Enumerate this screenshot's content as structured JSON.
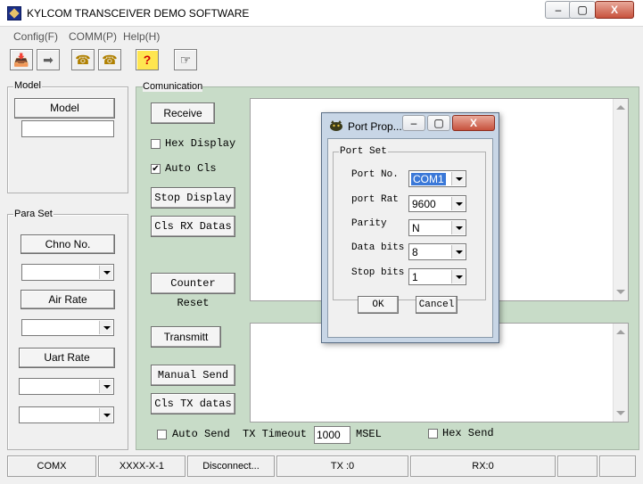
{
  "window": {
    "title": "KYLCOM TRANSCEIVER DEMO SOFTWARE",
    "minimize": "–",
    "maximize": "▢",
    "close": "X"
  },
  "menu": [
    {
      "label": "Config(F)"
    },
    {
      "label": "COMM(P)"
    },
    {
      "label": "Help(H)"
    }
  ],
  "toolbar": {
    "open": "📥",
    "send": "➡",
    "phone_call": "☎",
    "phone_hangup": "☎",
    "help": "?",
    "exit": "☞"
  },
  "model": {
    "group_label": "Model",
    "model_button": "Model",
    "model_value": ""
  },
  "para_set": {
    "group_label": "Para Set",
    "chno_button": "Chno No.",
    "chno_value": "",
    "air_rate_button": "Air Rate",
    "air_rate_value": "",
    "uart_rate_button": "Uart Rate",
    "uart_rate_value": "",
    "extra_value": ""
  },
  "comm": {
    "group_label": "Comunication",
    "receive_button": "Receive",
    "hex_display": "Hex Display",
    "auto_cls": "Auto Cls",
    "auto_cls_checked": true,
    "stop_display": "Stop Display",
    "cls_rx": "Cls RX Datas",
    "counter_reset": "Counter Reset",
    "transmit_button": "Transmitt",
    "manual_send": "Manual Send",
    "cls_tx": "Cls TX datas",
    "auto_send": "Auto Send",
    "tx_timeout_label": "TX Timeout",
    "tx_timeout_value": "1000",
    "msel": "MSEL",
    "hex_send": "Hex Send"
  },
  "status": {
    "port": "COMX",
    "model": "XXXX-X-1",
    "connection": "Disconnect...",
    "tx": "TX :0",
    "rx": "RX:0"
  },
  "dialog": {
    "title": "Port Prop...",
    "group_label": "Port Set",
    "port_no_label": "Port No.",
    "port_no_value": "COM1",
    "port_rate_label": "port Rat",
    "port_rate_value": "9600",
    "parity_label": "Parity",
    "parity_value": "N",
    "data_bits_label": "Data bits",
    "data_bits_value": "8",
    "stop_bits_label": "Stop bits",
    "stop_bits_value": "1",
    "ok": "OK",
    "cancel": "Cancel"
  }
}
